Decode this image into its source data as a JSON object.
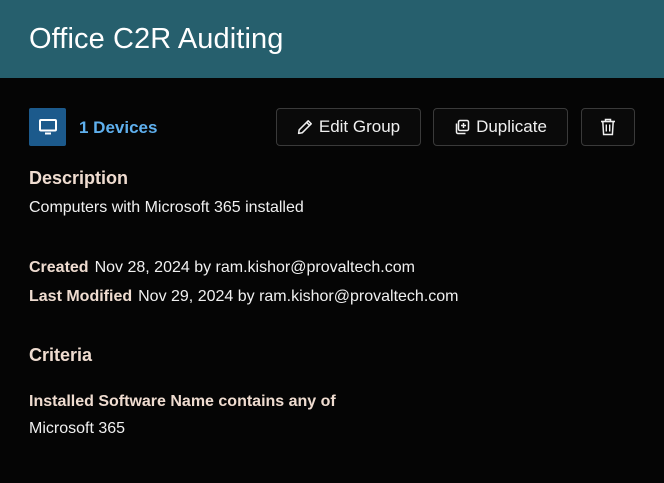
{
  "header": {
    "title": "Office C2R Auditing"
  },
  "toolbar": {
    "device_icon": "monitor-icon",
    "device_count_label": "1 Devices",
    "edit_label": "Edit Group",
    "duplicate_label": "Duplicate",
    "delete_icon": "trash-icon"
  },
  "description": {
    "heading": "Description",
    "text": "Computers with Microsoft 365 installed"
  },
  "meta": {
    "created_key": "Created",
    "created_value": "Nov 28, 2024 by ram.kishor@provaltech.com",
    "modified_key": "Last Modified",
    "modified_value": "Nov 29, 2024 by ram.kishor@provaltech.com"
  },
  "criteria": {
    "heading": "Criteria",
    "rule": "Installed Software Name contains any of",
    "value": "Microsoft 365"
  },
  "colors": {
    "header_bg": "#265f6d",
    "accent_link": "#5fb0ee",
    "device_icon_bg": "#1c5a8c",
    "page_bg": "#050505"
  }
}
